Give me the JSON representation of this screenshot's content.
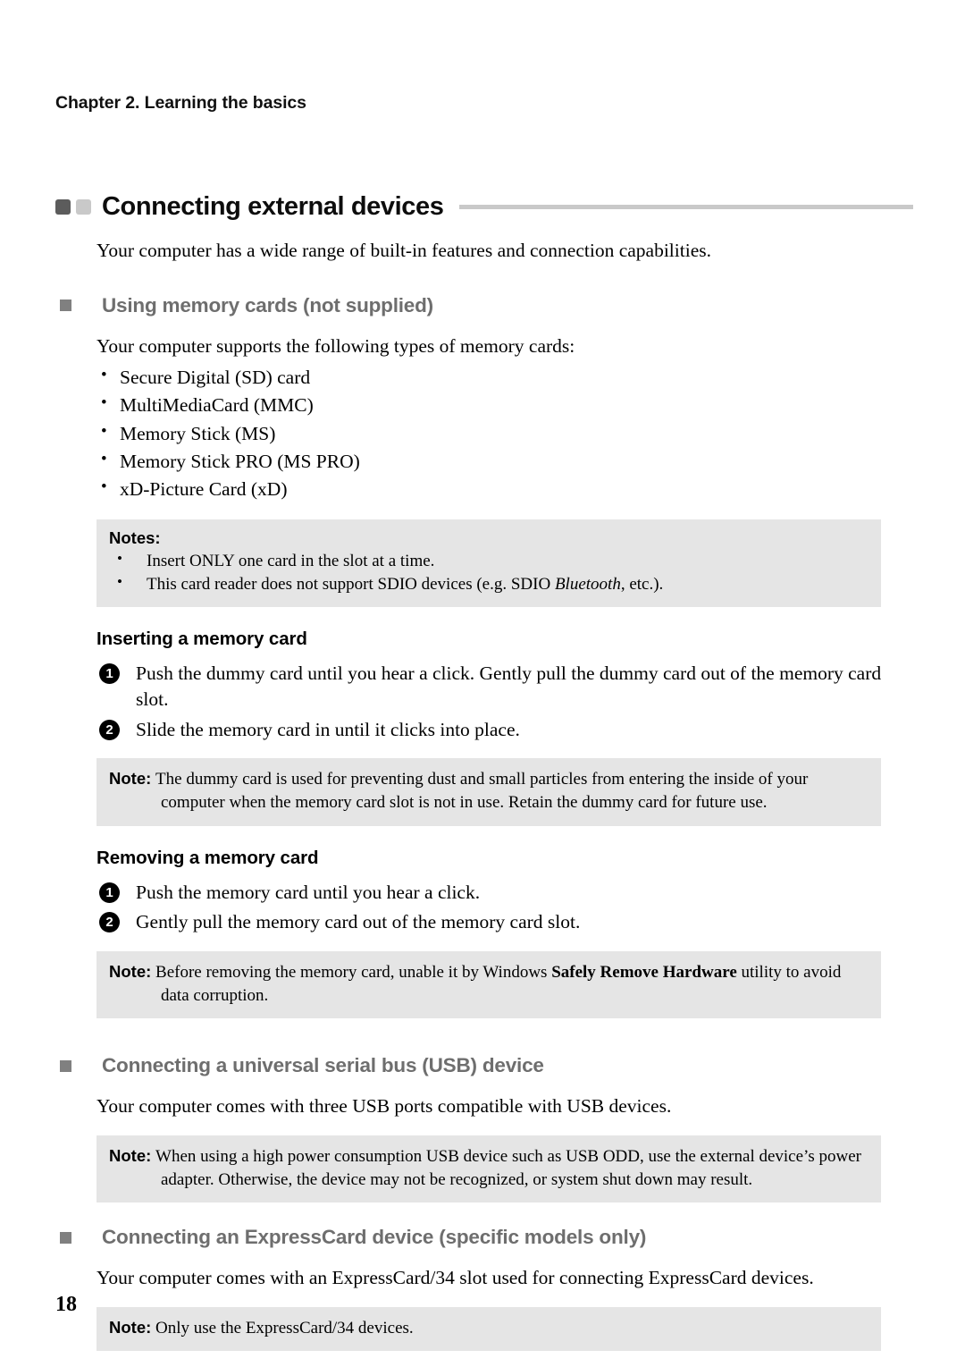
{
  "page": {
    "running_header": "Chapter 2. Learning the basics",
    "page_number": "18",
    "colors": {
      "heading_gray": "#6e6e6e",
      "note_background": "#e5e5e5",
      "rule_gray": "#c9c9c9",
      "square_dark": "#5c5c5c",
      "square_light": "#c9c9c9"
    }
  },
  "title": {
    "text": "Connecting external devices"
  },
  "intro": {
    "text": "Your computer has a wide range of built-in features and connection capabilities."
  },
  "sections": {
    "memory_cards": {
      "heading": "Using memory cards (not supplied)",
      "intro": "Your computer supports the following types of memory cards:",
      "card_types": [
        "Secure Digital (SD) card",
        "MultiMediaCard (MMC)",
        "Memory Stick (MS)",
        "Memory Stick PRO (MS PRO)",
        "xD-Picture Card (xD)"
      ],
      "notes_box": {
        "title": "Notes:",
        "items": [
          "Insert ONLY one card in the slot at a time.",
          "This card reader does not support SDIO devices (e.g. SDIO Bluetooth, etc.)."
        ],
        "item2_prefix": "This card reader does not support SDIO devices (e.g. SDIO ",
        "item2_italic": "Bluetooth",
        "item2_suffix": ", etc.)."
      },
      "inserting": {
        "heading": "Inserting a memory card",
        "steps": [
          {
            "number": "1",
            "text": "Push the dummy card until you hear a click. Gently pull the dummy card out of the memory card slot."
          },
          {
            "number": "2",
            "text": "Slide the memory card in until it clicks into place."
          }
        ],
        "note": {
          "label": "Note:",
          "text": "The dummy card is used for preventing dust and small particles from entering the inside of your computer when the memory card slot is not in use. Retain the dummy card for future use."
        }
      },
      "removing": {
        "heading": "Removing a memory card",
        "steps": [
          {
            "number": "1",
            "text": "Push the memory card until you hear a click."
          },
          {
            "number": "2",
            "text": "Gently pull the memory card out of the memory card slot."
          }
        ],
        "note": {
          "label": "Note:",
          "prefix": "Before removing the memory card, unable it by Windows ",
          "bold": "Safely Remove Hardware",
          "suffix": " utility to avoid data corruption."
        }
      }
    },
    "usb": {
      "heading": "Connecting a universal serial bus (USB) device",
      "body": "Your computer comes with three USB ports compatible with USB devices.",
      "note": {
        "label": "Note:",
        "text": "When using a high power consumption USB device such as USB ODD, use the external device’s power adapter. Otherwise, the device may not be recognized, or system shut down may result."
      }
    },
    "expresscard": {
      "heading": "Connecting an ExpressCard device (specific models only)",
      "body": "Your computer comes with an ExpressCard/34 slot used for connecting ExpressCard devices.",
      "note": {
        "label": "Note:",
        "text": "Only use the ExpressCard/34 devices."
      }
    }
  }
}
